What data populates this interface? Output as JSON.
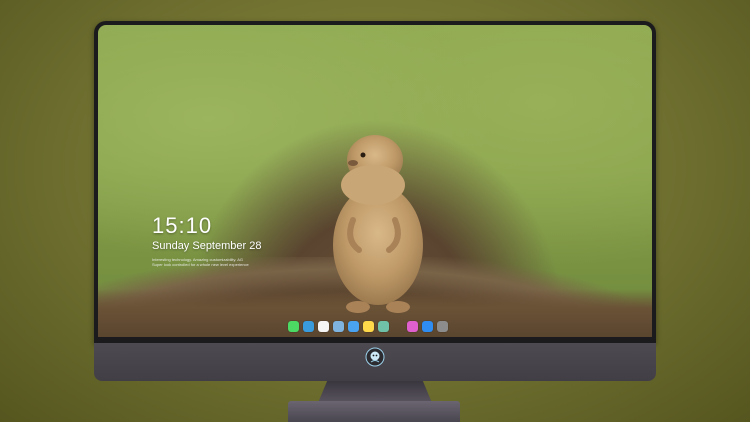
{
  "lock_screen": {
    "time": "15:10",
    "date": "Sunday September 28",
    "info_lines": [
      "Interesting technology. Amazing customizability. AG",
      "Super look controlled for a whole new level experience"
    ]
  },
  "dock": {
    "apps": [
      {
        "name": "messages-icon",
        "color": "#4cd964"
      },
      {
        "name": "finder-icon",
        "color": "#3a9bdc"
      },
      {
        "name": "safari-icon",
        "color": "#f5f5f5"
      },
      {
        "name": "preview-icon",
        "color": "#7fb3e0"
      },
      {
        "name": "mail-icon",
        "color": "#4aa3f0"
      },
      {
        "name": "notes-icon",
        "color": "#ffd94a"
      },
      {
        "name": "photos-icon",
        "color": "#6fc2a8"
      },
      {
        "name": "itunes-icon",
        "color": "#e060d0"
      },
      {
        "name": "app-store-icon",
        "color": "#2f8cf0"
      },
      {
        "name": "camera-icon",
        "color": "#8c8c8c"
      }
    ]
  },
  "colors": {
    "background": "#6f7030",
    "bezel": "#1b1b1d",
    "chin": "#4a464e"
  }
}
